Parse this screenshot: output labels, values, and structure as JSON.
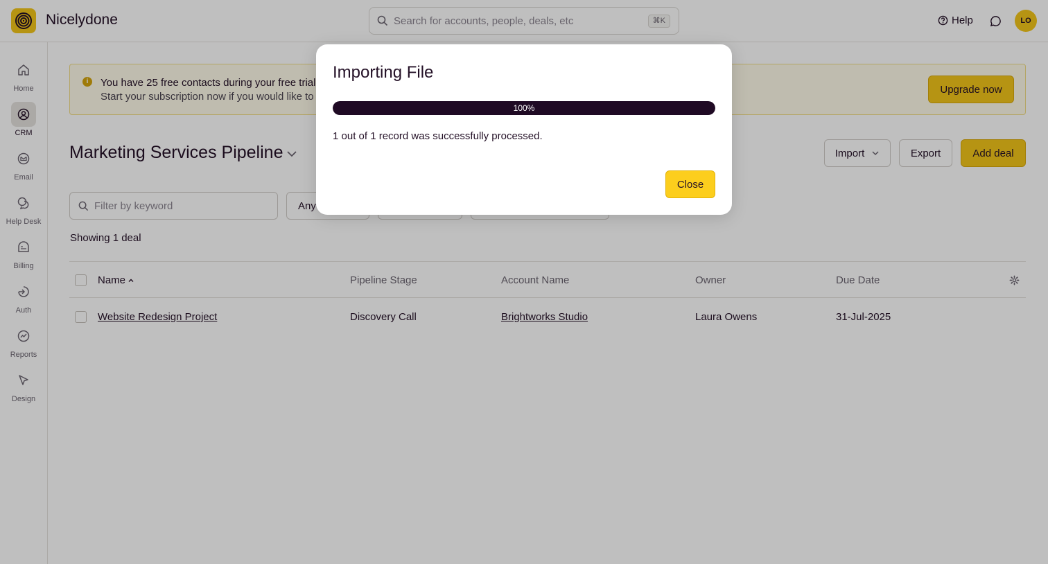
{
  "app": {
    "brand": "Nicelydone",
    "avatar_initials": "LO",
    "accent": "#f3c61a"
  },
  "search": {
    "placeholder": "Search for accounts, people, deals, etc",
    "shortcut": "⌘K"
  },
  "header": {
    "help_label": "Help"
  },
  "sidebar": {
    "items": [
      {
        "label": "Home",
        "icon": "home-icon"
      },
      {
        "label": "CRM",
        "icon": "crm-icon",
        "active": true
      },
      {
        "label": "Email",
        "icon": "email-icon"
      },
      {
        "label": "Help Desk",
        "icon": "help-desk-icon"
      },
      {
        "label": "Billing",
        "icon": "billing-icon"
      },
      {
        "label": "Auth",
        "icon": "auth-icon"
      },
      {
        "label": "Reports",
        "icon": "reports-icon"
      },
      {
        "label": "Design",
        "icon": "design-icon"
      }
    ]
  },
  "banner": {
    "line1": "You have 25 free contacts during your free trial",
    "line2": "Start your subscription now if you would like to i",
    "upgrade_label": "Upgrade now"
  },
  "main": {
    "pipeline_title": "Marketing Services Pipeline",
    "import_label": "Import",
    "export_label": "Export",
    "add_deal_label": "Add deal",
    "filter_placeholder": "Filter by keyword",
    "any_label": "Any",
    "showing": "Showing 1 deal"
  },
  "table": {
    "columns": [
      "Name",
      "Pipeline Stage",
      "Account Name",
      "Owner",
      "Due Date"
    ],
    "rows": [
      {
        "name": "Website Redesign Project",
        "stage": "Discovery Call",
        "account": "Brightworks Studio",
        "owner": "Laura Owens",
        "due": "31-Jul-2025"
      }
    ]
  },
  "modal": {
    "title": "Importing File",
    "progress": 1.0,
    "progress_label": "100%",
    "message": "1 out of 1 record was successfully processed.",
    "close_label": "Close"
  }
}
